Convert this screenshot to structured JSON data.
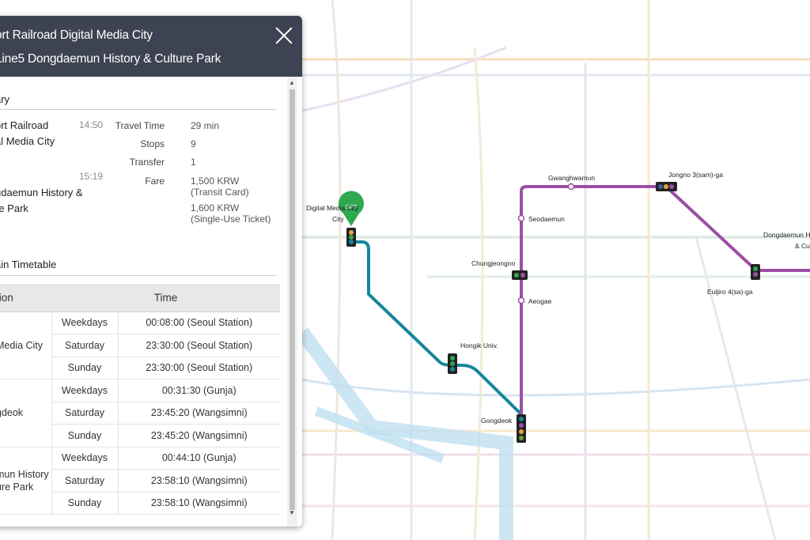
{
  "header": {
    "from_station": "ort Railroad Digital Media City",
    "to_station": "Line5 Dongdaemun History & Culture Park"
  },
  "summary": {
    "title": "ary",
    "depart_name_line1": "ort Railroad",
    "depart_name_line2": "al Media City",
    "depart_time": "14:50",
    "arrive_name_line1": "gdaemun History &",
    "arrive_name_line2": "re Park",
    "arrive_time": "15:19",
    "travel_time_label": "Travel Time",
    "travel_time_value": "29 min",
    "stops_label": "Stops",
    "stops_value": "9",
    "transfer_label": "Transfer",
    "transfer_value": "1",
    "fare_label": "Fare",
    "fare_card": "1,500 KRW",
    "fare_card_note": "(Transit Card)",
    "fare_ticket": "1,600 KRW",
    "fare_ticket_note": "(Single-Use Ticket)"
  },
  "timetable": {
    "title": "ain Timetable",
    "col_station": "tion",
    "col_time": "Time",
    "groups": [
      {
        "station_line1": "Media City",
        "station_line2": "",
        "rows": [
          {
            "day": "Weekdays",
            "time": "00:08:00 (Seoul Station)"
          },
          {
            "day": "Saturday",
            "time": "23:30:00 (Seoul Station)"
          },
          {
            "day": "Sunday",
            "time": "23:30:00 (Seoul Station)"
          }
        ]
      },
      {
        "station_line1": "gdeok",
        "station_line2": "",
        "rows": [
          {
            "day": "Weekdays",
            "time": "00:31:30 (Gunja)"
          },
          {
            "day": "Saturday",
            "time": "23:45:20 (Wangsimni)"
          },
          {
            "day": "Sunday",
            "time": "23:45:20 (Wangsimni)"
          }
        ]
      },
      {
        "station_line1": "mun History",
        "station_line2": "ure Park",
        "rows": [
          {
            "day": "Weekdays",
            "time": "00:44:10 (Gunja)"
          },
          {
            "day": "Saturday",
            "time": "23:58:10 (Wangsimni)"
          },
          {
            "day": "Sunday",
            "time": "23:58:10 (Wangsimni)"
          }
        ]
      }
    ]
  },
  "map": {
    "route_stations": {
      "digital_media_city": "Digital Media City",
      "dpt_badge": "DPT",
      "hongik": "Hongik Univ.",
      "gongdeok": "Gongdeok",
      "aeogae": "Aeogae",
      "chungjeongno": "Chungjeongno",
      "seodaemun": "Seodaemun",
      "gwanghwamun": "Gwanghwamun",
      "jongno3": "Jongno 3(sam)-ga",
      "euljiro4": "Euljiro 4(sa)-ga",
      "dongdaemun": "Dongdaemun Hi",
      "dongdaemun2": "& Cu"
    },
    "colors": {
      "route_airport": "#14869b",
      "route_line5": "#9b4ea4",
      "dpt_marker": "#2fa84f",
      "header_bg": "#3d4352"
    }
  }
}
